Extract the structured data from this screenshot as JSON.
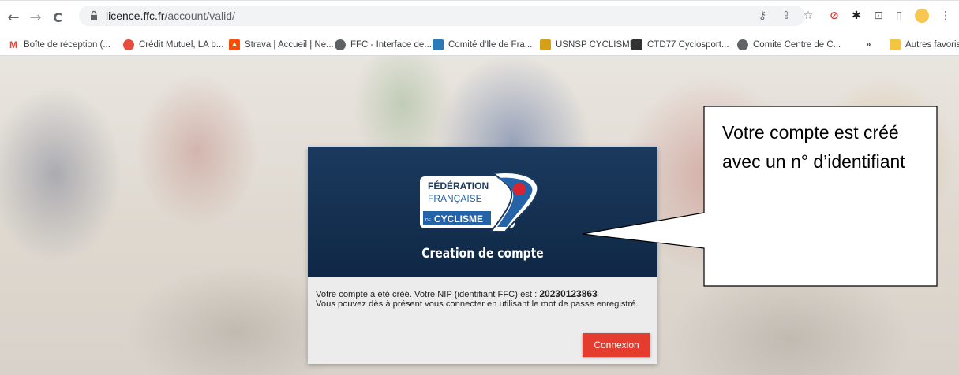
{
  "browser": {
    "url_host": "licence.ffc.fr",
    "url_path": "/account/valid/",
    "back_icon": "←",
    "forward_icon": "→",
    "reload_icon": "C"
  },
  "bookmarks": [
    {
      "label": "Boîte de réception (...",
      "icon": "gmail-icon",
      "color": "#ea4335"
    },
    {
      "label": "Crédit Mutuel, LA b...",
      "icon": "credit-mutuel-icon",
      "color": "#e74c3c"
    },
    {
      "label": "Strava | Accueil | Ne...",
      "icon": "strava-icon",
      "color": "#fc4c02"
    },
    {
      "label": "FFC - Interface de...",
      "icon": "globe-icon",
      "color": "#5f6368"
    },
    {
      "label": "Comité d'Ile de Fra...",
      "icon": "comite-icon",
      "color": "#2b7bb9"
    },
    {
      "label": "USNSP CYCLISME",
      "icon": "usnsp-icon",
      "color": "#d4a017"
    },
    {
      "label": "CTD77 Cyclosport...",
      "icon": "ctd77-icon",
      "color": "#333333"
    },
    {
      "label": "Comite Centre de C...",
      "icon": "globe-icon",
      "color": "#5f6368"
    }
  ],
  "bookmarks_more": "»",
  "other_bookmarks": "Autres favoris",
  "card": {
    "logo_line1": "FÉDÉRATION",
    "logo_line2": "FRANÇAISE",
    "logo_line3": "CYCLISME",
    "logo_prefix": "DE",
    "title": "Creation de compte",
    "message_prefix": "Votre compte a été créé. Votre NIP (identifiant FFC) est : ",
    "nip": "20230123863",
    "message_line2": "Vous pouvez dès à présent vous connecter en utilisant le mot de passe enregistré.",
    "button_label": "Connexion",
    "button_color": "#e53c30",
    "header_color": "#1b3a5e"
  },
  "callout": {
    "text": "Votre compte est créé avec un n° d’identifiant"
  }
}
